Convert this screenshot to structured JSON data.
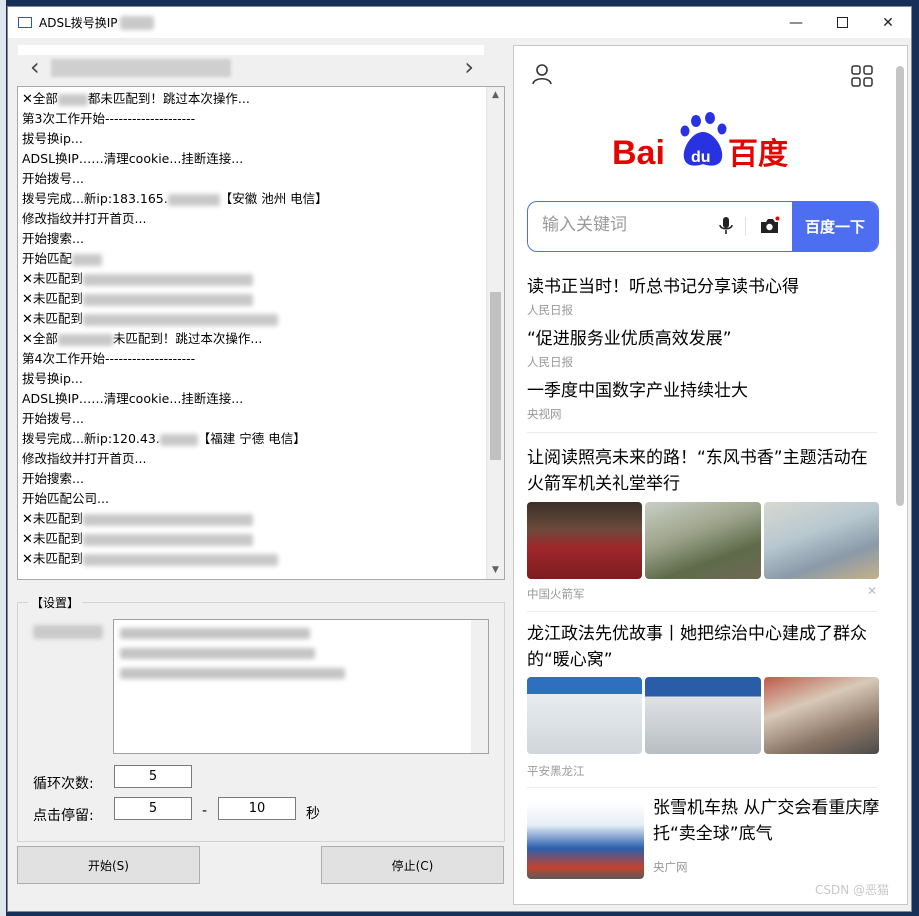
{
  "window": {
    "title": "ADSL拨号换IP"
  },
  "window_controls": {
    "minimize": "—",
    "close": "✕"
  },
  "nav": {
    "left": "‹",
    "right": "›"
  },
  "log": {
    "lines": [
      {
        "x": true,
        "pre": "全部",
        "blur": 30,
        "post": "都未匹配到！跳过本次操作..."
      },
      {
        "x": false,
        "pre": "第3次工作开始--------------------",
        "blur": 0,
        "post": ""
      },
      {
        "x": false,
        "pre": "拔号换ip...",
        "blur": 0,
        "post": ""
      },
      {
        "x": false,
        "pre": "ADSL换IP……清理cookie...挂断连接...",
        "blur": 0,
        "post": ""
      },
      {
        "x": false,
        "pre": "开始拨号...",
        "blur": 0,
        "post": ""
      },
      {
        "x": false,
        "pre": "拨号完成...新ip:183.165.",
        "blur": 52,
        "post": "【安徽 池州  电信】"
      },
      {
        "x": false,
        "pre": "修改指纹并打开首页...",
        "blur": 0,
        "post": ""
      },
      {
        "x": false,
        "pre": "开始搜索...",
        "blur": 0,
        "post": ""
      },
      {
        "x": false,
        "pre": "开始匹配",
        "blur": 30,
        "post": ""
      },
      {
        "x": true,
        "pre": "未匹配到",
        "blur": 170,
        "post": ""
      },
      {
        "x": true,
        "pre": "未匹配到",
        "blur": 170,
        "post": ""
      },
      {
        "x": true,
        "pre": "未匹配到",
        "blur": 195,
        "post": ""
      },
      {
        "x": true,
        "pre": "全部",
        "blur": 55,
        "post": "未匹配到！跳过本次操作..."
      },
      {
        "x": false,
        "pre": "第4次工作开始--------------------",
        "blur": 0,
        "post": ""
      },
      {
        "x": false,
        "pre": "拔号换ip...",
        "blur": 0,
        "post": ""
      },
      {
        "x": false,
        "pre": "ADSL换IP……清理cookie...挂断连接...",
        "blur": 0,
        "post": ""
      },
      {
        "x": false,
        "pre": "开始拨号...",
        "blur": 0,
        "post": ""
      },
      {
        "x": false,
        "pre": "拨号完成...新ip:120.43.",
        "blur": 38,
        "post": "【福建 宁德  电信】"
      },
      {
        "x": false,
        "pre": "修改指纹并打开首页...",
        "blur": 0,
        "post": ""
      },
      {
        "x": false,
        "pre": "开始搜索...",
        "blur": 0,
        "post": ""
      },
      {
        "x": false,
        "pre": "开始匹配公司...",
        "blur": 0,
        "post": ""
      },
      {
        "x": true,
        "pre": "未匹配到",
        "blur": 170,
        "post": ""
      },
      {
        "x": true,
        "pre": "未匹配到",
        "blur": 170,
        "post": ""
      },
      {
        "x": true,
        "pre": "未匹配到",
        "blur": 195,
        "post": ""
      }
    ]
  },
  "settings": {
    "legend": "【设置】",
    "loop_label": "循环次数:",
    "loop_value": "5",
    "stay_label": "点击停留:",
    "stay_min": "5",
    "dash": "-",
    "stay_max": "10",
    "unit": "秒"
  },
  "buttons": {
    "start": "开始(S)",
    "stop": "停止(C)"
  },
  "browser": {
    "logo_bai": "Bai",
    "logo_du": "du",
    "logo_cn": "百度",
    "search_placeholder": "输入关键词",
    "search_button": "百度一下",
    "news": [
      {
        "title": "读书正当时！听总书记分享读书心得",
        "source": "人民日报"
      },
      {
        "title": "“促进服务业优质高效发展”",
        "source": "人民日报"
      },
      {
        "title": "一季度中国数字产业持续壮大",
        "source": "央视网"
      },
      {
        "title": "让阅读照亮未来的路！“东风书香”主题活动在火箭军机关礼堂举行",
        "source": "中国火箭军"
      },
      {
        "title": "龙江政法先优故事丨她把综治中心建成了群众的“暖心窝”",
        "source": "平安黑龙江"
      },
      {
        "title": "张雪机车热 从广交会看重庆摩托“卖全球”底气",
        "source": "央广网"
      }
    ],
    "close_mark": "✕",
    "watermark": "CSDN @恶猫"
  },
  "colors": {
    "baidu_red": "#e10601",
    "baidu_blue": "#2932e1",
    "search_blue": "#4e6ef2"
  }
}
